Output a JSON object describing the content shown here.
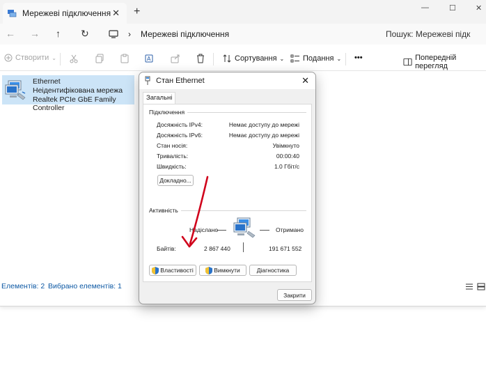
{
  "window": {
    "tab_title": "Мережеві підключення",
    "new_tab": "+",
    "minimize": "—",
    "maximize": "☐",
    "close": "✕"
  },
  "address": {
    "location": "Мережеві підключення",
    "search_placeholder": "Пошук: Мережеві підк"
  },
  "toolbar": {
    "create_label": "Створити",
    "sort_label": "Сортування",
    "view_label": "Подання",
    "more_label": "•••",
    "preview_label": "Попередній перегляд"
  },
  "item": {
    "name": "Ethernet",
    "status": "Неідентифікована мережа",
    "adapter": "Realtek PCIe GbE Family Controller"
  },
  "statusbar": {
    "elements": "Елементів: 2",
    "selected": "Вибрано елементів: 1"
  },
  "dialog": {
    "title": "Стан Ethernet",
    "tab": "Загальні",
    "connection_group": "Підключення",
    "rows": [
      {
        "label": "Досяжність IPv4:",
        "value": "Немає доступу до мережі"
      },
      {
        "label": "Досяжність IPv6:",
        "value": "Немає доступу до мережі"
      },
      {
        "label": "Стан носія:",
        "value": "Увімкнуто"
      },
      {
        "label": "Тривалість:",
        "value": "00:00:40"
      },
      {
        "label": "Швидкість:",
        "value": "1.0 Гбіт/с"
      }
    ],
    "details_button": "Докладно...",
    "activity_group": "Активність",
    "sent_label": "Надіслано",
    "received_label": "Отримано",
    "bytes_label": "Байтів:",
    "bytes_sent": "2 867 440",
    "bytes_received": "191 671 552",
    "properties_button": "Властивості",
    "disable_button": "Вимкнути",
    "diagnostics_button": "Діагностика",
    "close_button": "Закрити"
  },
  "colors": {
    "selection": "#cce4f7",
    "status_link": "#0b57a3",
    "annotation_arrow": "#d0021b"
  }
}
